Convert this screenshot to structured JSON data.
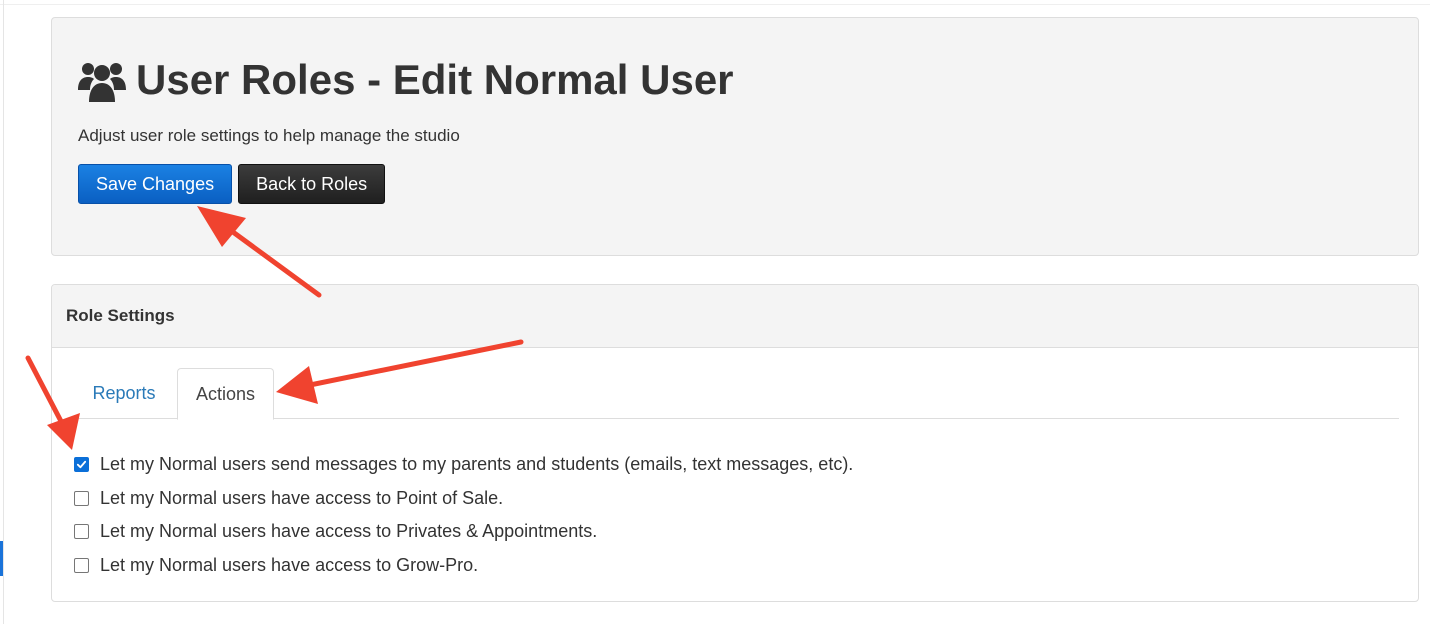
{
  "header": {
    "icon": "users-icon",
    "title": "User Roles - Edit Normal User",
    "subtitle": "Adjust user role settings to help manage the studio",
    "buttons": {
      "save_label": "Save Changes",
      "back_label": "Back to Roles"
    }
  },
  "role_settings": {
    "heading": "Role Settings",
    "tabs": [
      {
        "label": "Reports",
        "active": false
      },
      {
        "label": "Actions",
        "active": true
      }
    ],
    "options": [
      {
        "label": "Let my Normal users send messages to my parents and students (emails, text messages, etc).",
        "checked": true
      },
      {
        "label": "Let my Normal users have access to Point of Sale.",
        "checked": false
      },
      {
        "label": "Let my Normal users have access to Privates & Appointments.",
        "checked": false
      },
      {
        "label": "Let my Normal users have access to Grow-Pro.",
        "checked": false
      }
    ]
  },
  "colors": {
    "primary_button": "#0a5fc2",
    "dark_button": "#2a2a2a",
    "tab_link": "#2a7ab8",
    "annotation_arrow": "#f0432f",
    "checkbox_checked": "#0b6fd8"
  }
}
